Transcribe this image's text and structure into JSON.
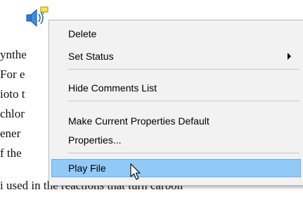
{
  "document": {
    "lines": [
      "ynthe",
      "For e",
      "ioto t",
      "chlor",
      "ener",
      "f the",
      "i used in the reactions that turn carbon"
    ]
  },
  "context_menu": {
    "items": {
      "delete": "Delete",
      "set_status": "Set Status",
      "hide_comments_list": "Hide Comments List",
      "make_default": "Make Current Properties Default",
      "properties": "Properties...",
      "play_file": "Play File"
    },
    "highlighted_item": "Play File"
  },
  "icons": {
    "annotation": "speaker-with-note-icon",
    "submenu": "submenu-arrow-icon",
    "cursor": "mouse-pointer-icon"
  },
  "colors": {
    "menu_background": "#f2f2f2",
    "highlight": "#91c9f7",
    "highlight_border": "#6ab1ee",
    "speaker_blue": "#2a7fd8"
  }
}
